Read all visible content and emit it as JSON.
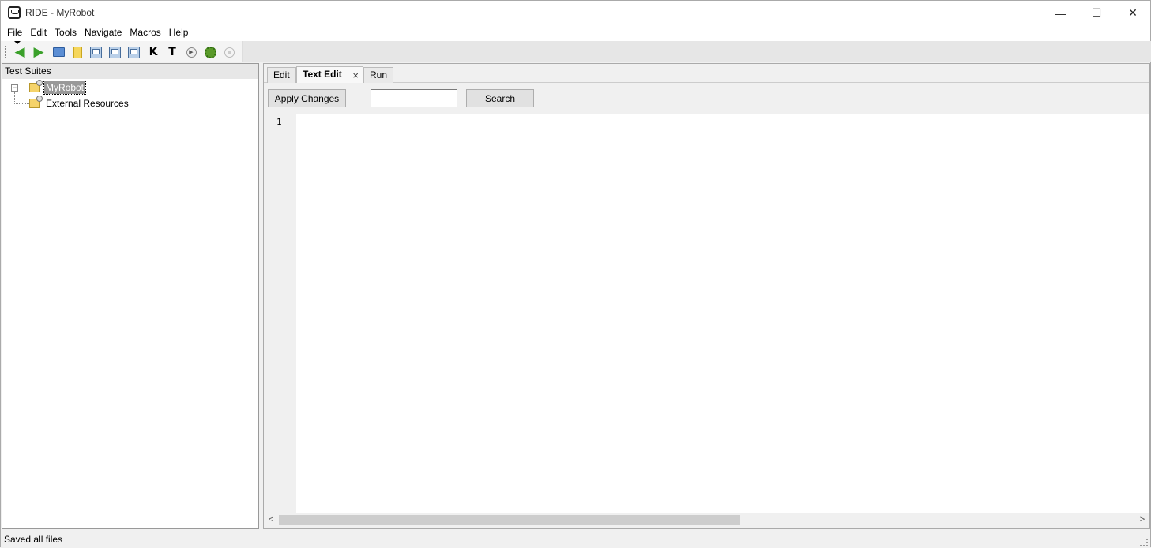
{
  "window": {
    "title": "RIDE - MyRobot",
    "controls": {
      "minimize": "—",
      "maximize": "☐",
      "close": "✕"
    }
  },
  "menubar": {
    "items": [
      "File",
      "Edit",
      "Tools",
      "Navigate",
      "Macros",
      "Help"
    ]
  },
  "toolbar": {
    "buttons": [
      {
        "name": "back-icon",
        "glyph": "◀"
      },
      {
        "name": "forward-icon",
        "glyph": "▶"
      },
      {
        "name": "open-folder-icon"
      },
      {
        "name": "new-file-icon"
      },
      {
        "name": "save-icon"
      },
      {
        "name": "save-all-icon"
      },
      {
        "name": "save-as-icon"
      },
      {
        "name": "search-keywords-icon",
        "glyph": "K"
      },
      {
        "name": "search-tests-icon",
        "glyph": "T"
      },
      {
        "name": "run-icon",
        "glyph": "▶"
      },
      {
        "name": "debug-icon"
      },
      {
        "name": "stop-icon"
      }
    ]
  },
  "left_panel": {
    "header": "Test Suites",
    "tree": {
      "expander": "−",
      "nodes": [
        {
          "label": "MyRobot",
          "selected": true
        },
        {
          "label": "External Resources",
          "selected": false
        }
      ]
    }
  },
  "right_panel": {
    "tabs": [
      {
        "label": "Edit",
        "active": false
      },
      {
        "label": "Text Edit",
        "active": true,
        "close": "×"
      },
      {
        "label": "Run",
        "active": false
      }
    ],
    "text_edit": {
      "apply_label": "Apply Changes",
      "search_value": "",
      "search_button": "Search",
      "line_numbers": [
        "1"
      ],
      "scroll": {
        "left_arrow": "<",
        "right_arrow": ">"
      }
    }
  },
  "statusbar": {
    "text": "Saved all files"
  }
}
